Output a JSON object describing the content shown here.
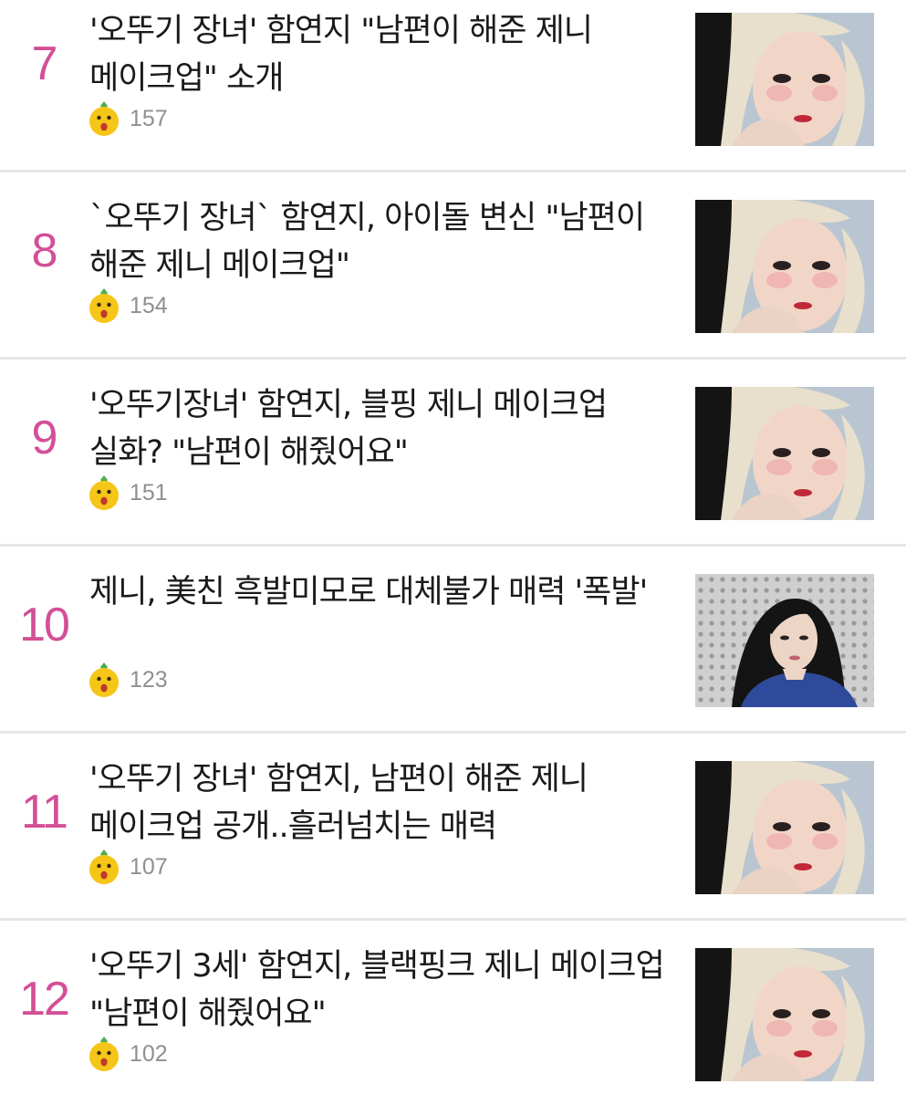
{
  "articles": [
    {
      "rank": "7",
      "title": "'오뚜기 장녀' 함연지 \"남편이 해준 제니 메이크업\" 소개",
      "reactions": "157",
      "thumbnail": "hamyeonji-photo"
    },
    {
      "rank": "8",
      "title": "`오뚜기 장녀` 함연지, 아이돌 변신 \"남편이 해준 제니 메이크업\"",
      "reactions": "154",
      "thumbnail": "hamyeonji-photo"
    },
    {
      "rank": "9",
      "title": "'오뚜기장녀' 함연지, 블핑 제니 메이크업 실화? \"남편이 해줬어요\"",
      "reactions": "151",
      "thumbnail": "hamyeonji-photo"
    },
    {
      "rank": "10",
      "title": "제니, 美친 흑발미모로 대체불가 매력 '폭발'",
      "reactions": "123",
      "thumbnail": "jennie-photo"
    },
    {
      "rank": "11",
      "title": "'오뚜기 장녀' 함연지, 남편이 해준 제니 메이크업 공개..흘러넘치는 매력",
      "reactions": "107",
      "thumbnail": "hamyeonji-photo"
    },
    {
      "rank": "12",
      "title": "'오뚜기 3세' 함연지, 블랙핑크 제니 메이크업 \"남편이 해줬어요\"",
      "reactions": "102",
      "thumbnail": "hamyeonji-photo"
    }
  ],
  "colors": {
    "rank": "#d34f96",
    "count": "#8f8f8f",
    "divider": "#e6e6e6"
  },
  "icons": {
    "reaction": "surprised-face-emoji-icon"
  }
}
